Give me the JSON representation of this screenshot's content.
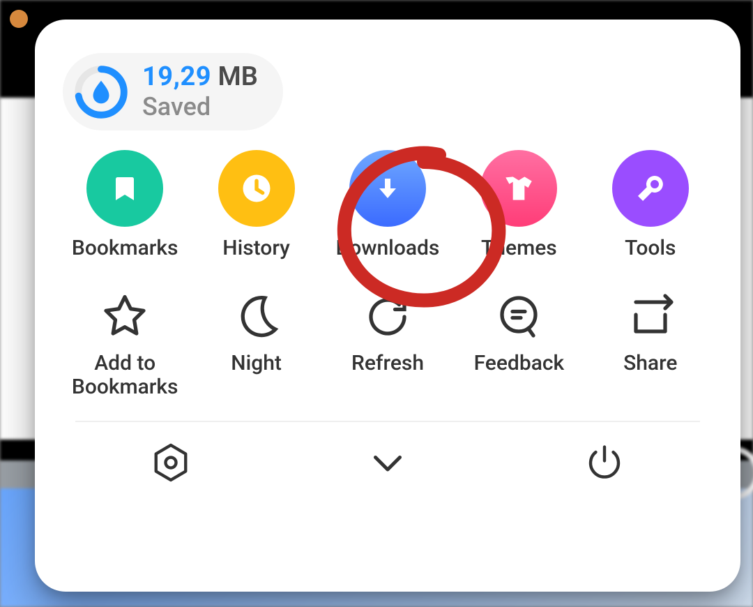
{
  "data_saver": {
    "amount": "19,29",
    "unit": "MB",
    "label": "Saved",
    "progress_fraction": 0.72
  },
  "primary_actions": [
    {
      "id": "bookmarks",
      "label": "Bookmarks",
      "icon": "bookmark-icon",
      "color": "#18c9a0"
    },
    {
      "id": "history",
      "label": "History",
      "icon": "clock-icon",
      "color": "#ffbf12"
    },
    {
      "id": "downloads",
      "label": "Downloads",
      "icon": "download-icon",
      "color": "#4d86ff"
    },
    {
      "id": "themes",
      "label": "Themes",
      "icon": "tshirt-icon",
      "color": "#ff3d78"
    },
    {
      "id": "tools",
      "label": "Tools",
      "icon": "wrench-icon",
      "color": "#9a4dff"
    }
  ],
  "secondary_actions": [
    {
      "id": "add-bookmark",
      "label": "Add to Bookmarks",
      "icon": "star-icon"
    },
    {
      "id": "night",
      "label": "Night",
      "icon": "moon-icon"
    },
    {
      "id": "refresh",
      "label": "Refresh",
      "icon": "refresh-icon"
    },
    {
      "id": "feedback",
      "label": "Feedback",
      "icon": "chat-icon"
    },
    {
      "id": "share",
      "label": "Share",
      "icon": "share-icon"
    }
  ],
  "bottom_bar": [
    {
      "id": "settings",
      "icon": "settings-hex-icon"
    },
    {
      "id": "collapse",
      "icon": "chevron-down-icon"
    },
    {
      "id": "exit",
      "icon": "power-icon"
    }
  ],
  "annotation": {
    "target_id": "downloads",
    "kind": "hand-circle",
    "color": "#cc2a24"
  }
}
